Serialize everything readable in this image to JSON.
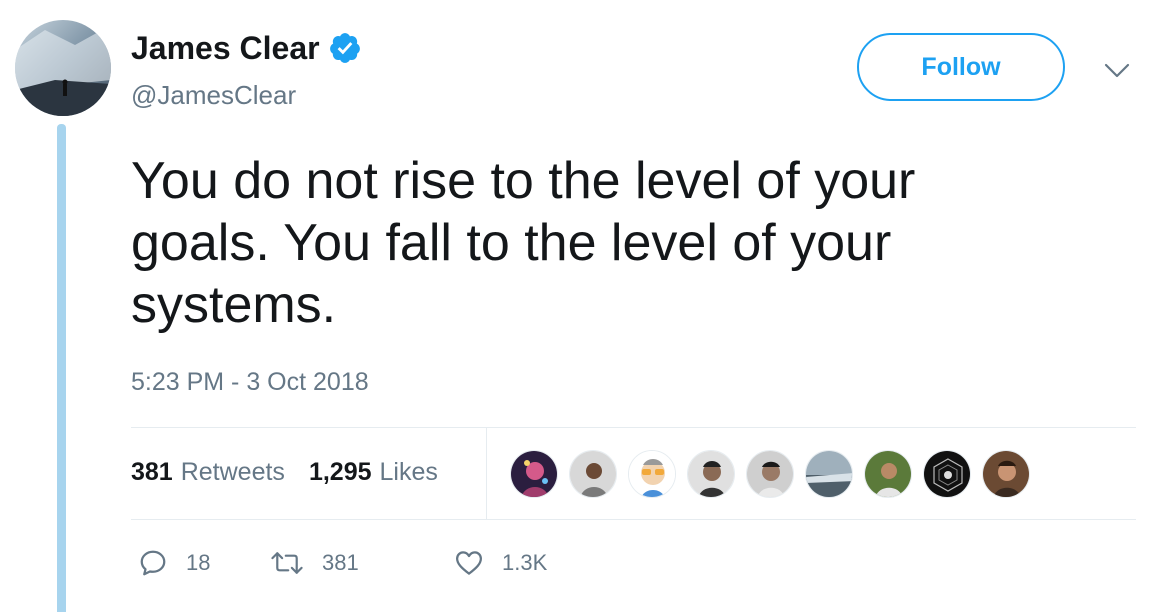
{
  "author": {
    "name": "James Clear",
    "handle": "@JamesClear",
    "verified": true
  },
  "follow_button": {
    "label": "Follow"
  },
  "tweet": {
    "text": "You do not rise to the level of your goals. You fall to the level of your systems.",
    "timestamp": "5:23 PM - 3 Oct 2018"
  },
  "stats": {
    "retweets_count": "381",
    "retweets_label": "Retweets",
    "likes_count": "1,295",
    "likes_label": "Likes"
  },
  "likers": [
    {
      "icon": "liker-avatar-1",
      "color": "#3a2a52"
    },
    {
      "icon": "liker-avatar-2",
      "color": "#b8b8b8"
    },
    {
      "icon": "liker-avatar-3",
      "color": "#f2c94c"
    },
    {
      "icon": "liker-avatar-4",
      "color": "#555555"
    },
    {
      "icon": "liker-avatar-5",
      "color": "#8a8a8a"
    },
    {
      "icon": "liker-avatar-6",
      "color": "#6f7f8a"
    },
    {
      "icon": "liker-avatar-7",
      "color": "#5b7a3a"
    },
    {
      "icon": "liker-avatar-8",
      "color": "#1e1e1e"
    },
    {
      "icon": "liker-avatar-9",
      "color": "#7a5a40"
    }
  ],
  "actions": {
    "reply_count": "18",
    "retweet_count": "381",
    "like_count": "1.3K"
  },
  "colors": {
    "accent": "#1da1f2",
    "thread_line": "#a7d4ee",
    "muted_text": "#657786",
    "primary_text": "#14171a"
  }
}
